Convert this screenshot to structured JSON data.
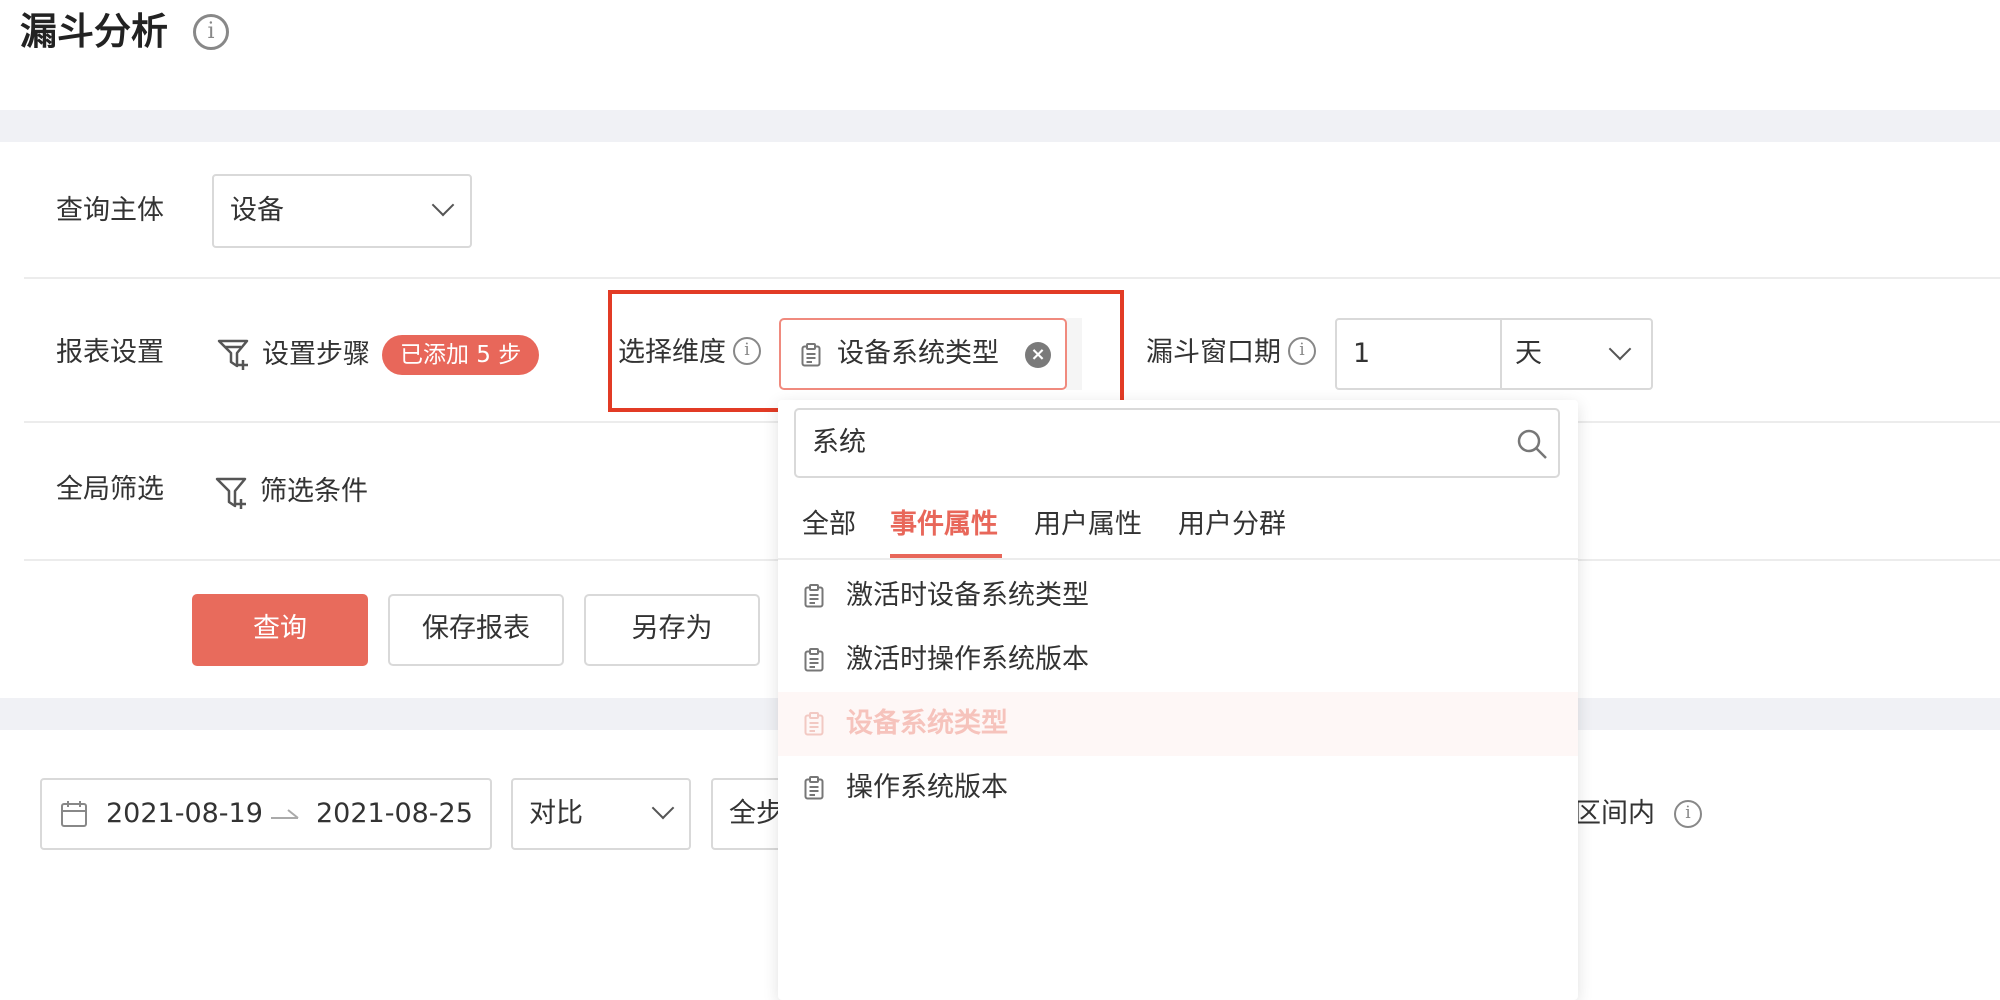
{
  "page": {
    "title": "漏斗分析"
  },
  "query_subject": {
    "label": "查询主体",
    "value": "设备"
  },
  "report_settings": {
    "label": "报表设置",
    "set_steps_label": "设置步骤",
    "steps_badge": "已添加 5 步",
    "dimension_label": "选择维度",
    "dimension_chip": "设备系统类型",
    "window_label": "漏斗窗口期",
    "window_value": "1",
    "window_unit": "天"
  },
  "global_filter": {
    "label": "全局筛选",
    "filter_label": "筛选条件"
  },
  "actions": {
    "query": "查询",
    "save_report": "保存报表",
    "save_as": "另存为"
  },
  "results_bar": {
    "date_start": "2021-08-19",
    "date_end": "2021-08-25",
    "compare": "对比",
    "steps_select_partial": "全步",
    "interval_text_partial": "区间内"
  },
  "dimension_dropdown": {
    "search_value": "系统",
    "tabs": [
      "全部",
      "事件属性",
      "用户属性",
      "用户分群"
    ],
    "active_tab": "事件属性",
    "options": [
      {
        "label": "激活时设备系统类型",
        "selected": false
      },
      {
        "label": "激活时操作系统版本",
        "selected": false
      },
      {
        "label": "设备系统类型",
        "selected": true
      },
      {
        "label": "操作系统版本",
        "selected": false
      }
    ]
  },
  "colors": {
    "accent": "#e8675a",
    "highlight_frame": "#e23b25",
    "band": "#f0f1f5"
  }
}
